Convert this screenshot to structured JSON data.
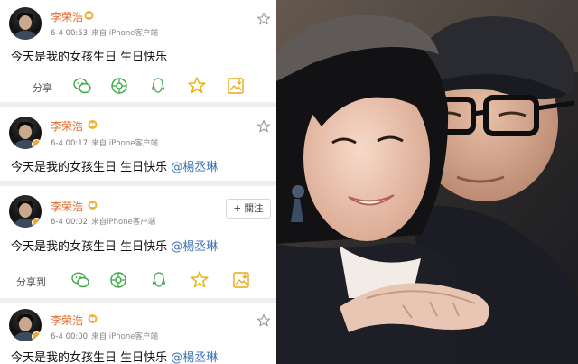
{
  "posts": [
    {
      "author": "李荣浩",
      "time": "6-4 00:53",
      "source": "来自 iPhone客户端",
      "text": "今天是我的女孩生日 生日快乐",
      "mention": ""
    },
    {
      "author": "李荣浩",
      "time": "6-4 00:17",
      "source": "来自 iPhone客户端",
      "text": "今天是我的女孩生日 生日快乐 ",
      "mention": "@楊丞琳"
    },
    {
      "author": "李荣浩",
      "time": "6-4 00:02",
      "source": "来自iPhone客户端",
      "text": "今天是我的女孩生日 生日快乐 ",
      "mention": "@楊丞琳"
    },
    {
      "author": "李荣浩",
      "time": "6-4 00:00",
      "source": "来自 iPhone客户端",
      "text": "今天是我的女孩生日 生日快乐 ",
      "mention": "@楊丞琳"
    }
  ],
  "share_rows": [
    {
      "label": "分享"
    },
    {
      "label": "分享到"
    }
  ],
  "follow_button": {
    "label": "+ 關注"
  },
  "icons": {
    "avatar": "avatar-icon",
    "crown": "crown-badge-icon",
    "star": "star-icon",
    "wechat": "wechat-icon",
    "moments": "moments-icon",
    "qq": "qq-icon",
    "qzone": "qzone-star-icon",
    "save": "save-image-icon"
  },
  "colors": {
    "author": "#e06a2c",
    "mention": "#3b6fb6",
    "share_icon": "#3aa845",
    "qzone_star": "#e8b400",
    "save_icon": "#e6a817"
  }
}
